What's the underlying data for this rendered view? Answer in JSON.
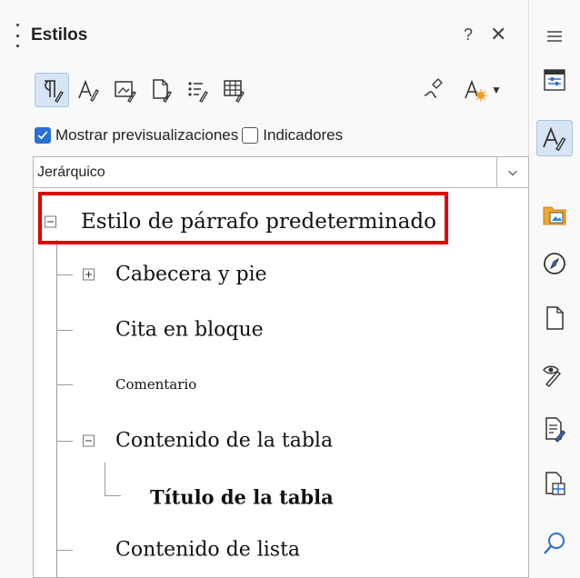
{
  "panel": {
    "title": "Estilos",
    "help_label": "?",
    "close_label": "✕"
  },
  "toolbar": {
    "buttons": [
      {
        "icon": "paragraph-styles-icon",
        "active": true
      },
      {
        "icon": "character-styles-icon"
      },
      {
        "icon": "frame-styles-icon"
      },
      {
        "icon": "page-styles-icon"
      },
      {
        "icon": "list-styles-icon"
      },
      {
        "icon": "table-styles-icon"
      },
      {
        "icon": "fill-format-mode-icon"
      },
      {
        "icon": "new-style-from-selection-icon"
      }
    ]
  },
  "options": {
    "show_previews": {
      "label": "Mostrar previsualizaciones",
      "checked": true
    },
    "indicators": {
      "label": "Indicadores",
      "checked": false
    }
  },
  "filter": {
    "value": "Jerárquico"
  },
  "tree": {
    "items": [
      {
        "label": "Estilo de párrafo predeterminado",
        "level": 0,
        "expander": "minus",
        "selected_highlight": true
      },
      {
        "label": "Cabecera y pie",
        "level": 1,
        "expander": "plus"
      },
      {
        "label": "Cita en bloque",
        "level": 1
      },
      {
        "label": "Comentario",
        "level": 1
      },
      {
        "label": "Contenido de la tabla",
        "level": 1,
        "expander": "minus"
      },
      {
        "label": "Título de la tabla",
        "level": 2,
        "bold": true
      },
      {
        "label": "Contenido de lista",
        "level": 1
      }
    ]
  },
  "sidebar": {
    "menu_icon": "hamburger-menu-icon",
    "tabs": [
      {
        "icon": "properties-icon"
      },
      {
        "icon": "styles-icon",
        "active": true
      },
      {
        "icon": "gallery-icon"
      },
      {
        "icon": "navigator-icon"
      },
      {
        "icon": "page-icon"
      },
      {
        "icon": "style-inspector-icon"
      },
      {
        "icon": "manage-changes-icon"
      },
      {
        "icon": "design-icon"
      },
      {
        "icon": "find-icon"
      }
    ]
  },
  "colors": {
    "highlight_border": "#e00000",
    "active_bg": "#d6e4f3",
    "checkbox": "#2a6fd1"
  }
}
